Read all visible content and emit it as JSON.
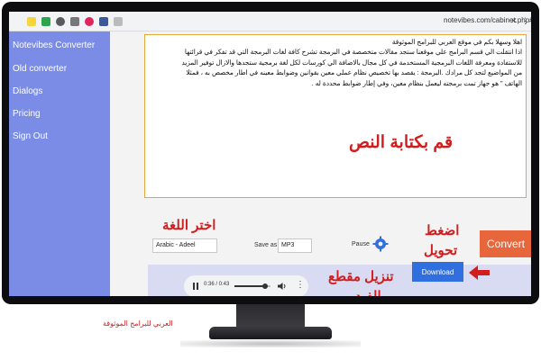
{
  "browser": {
    "url": "notevibes.com/cabinet.php#!"
  },
  "sidebar": {
    "items": [
      {
        "label": "Notevibes Converter"
      },
      {
        "label": "Old converter"
      },
      {
        "label": "Dialogs"
      },
      {
        "label": "Pricing"
      },
      {
        "label": "Sign Out"
      }
    ]
  },
  "editor": {
    "lines": [
      "اهلا وسهلا بكم في موقع العربي للبرامج الموثوقة",
      "اذا انتقلت الي قسم البرامج علي موقعنا ستجد مقالات متخصصة في البرمجة تشرح كافة لغات البرمجة التي قد تفكر في قرائتها",
      "للاستفادة ومعرفة اللغات البرمجية المستخدمة في كل مجال بالاضافة الي كورسات لكل لغة برمجية ستجدها والازال توفير المزيد",
      "من المواضيع لتجد كل مرادك .البرمجة : يقصد بها تخصيص نظام عملي معين بقوانين وضوابط معينه في اطار مخصص به ، فمثلا",
      "الهاتف \" هو جهاز تمت برمجته ليعمل بنظام معين، وفي إطار ضوابط محددة له ."
    ]
  },
  "annotations": {
    "write_text": "قم بكتابة النص",
    "choose_language": "اختر اللغة",
    "press_convert_1": "اضغط",
    "press_convert_2": "تحويل",
    "download_video_1": "تنزيل مقطع",
    "download_video_2": "الفيديو"
  },
  "controls": {
    "voice_value": "Arabic - Adeel",
    "save_as_label": "Save as",
    "format_value": "MP3",
    "pause_label": "Pause",
    "convert_label": "Convert"
  },
  "player": {
    "time": "0:36 / 0:43",
    "progress": 0.84
  },
  "download": {
    "label": "Download"
  },
  "caption": "العربي للبرامج الموثوقة",
  "colors": {
    "sidebar": "#7b8ce6",
    "convert": "#e8663b",
    "download": "#2f6fe0",
    "annotation": "#d11d1d",
    "editor_border": "#e3a93c"
  }
}
